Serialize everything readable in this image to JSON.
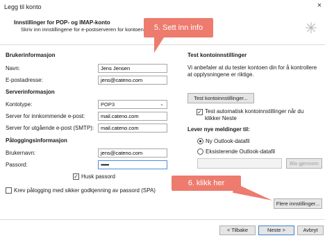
{
  "window": {
    "title": "Legg til konto",
    "close_glyph": "×"
  },
  "header": {
    "title": "Innstillinger for POP- og IMAP-konto",
    "subtitle": "Skriv inn innstillingene for e-postserveren for kontoen din.",
    "icon": "sparkle-cursor-icon"
  },
  "user_info": {
    "heading": "Brukerinformasjon",
    "name_label": "Navn:",
    "name_value": "Jens Jensen",
    "email_label": "E-postadresse:",
    "email_value": "jens@cateno.com"
  },
  "server_info": {
    "heading": "Serverinformasjon",
    "account_type_label": "Kontotype:",
    "account_type_value": "POP3",
    "incoming_label": "Server for innkommende e-post:",
    "incoming_value": "mail.cateno.com",
    "outgoing_label": "Server for utgående e-post (SMTP):",
    "outgoing_value": "mail.cateno.com"
  },
  "login_info": {
    "heading": "Påloggingsinformasjon",
    "username_label": "Brukernavn:",
    "username_value": "jens@cateno.com",
    "password_label": "Passord:",
    "password_value": "•••••••",
    "remember_label": "Husk passord",
    "remember_checked": true,
    "spa_label": "Krev pålogging med sikker godkjenning av passord (SPA)",
    "spa_checked": false
  },
  "test_settings": {
    "heading": "Test kontoinnstillinger",
    "description": "Vi anbefaler at du tester kontoen din for å kontrollere at opplysningene er riktige.",
    "test_button": "Test kontoinnstillinger...",
    "auto_test_label": "Test automatisk kontoinnstillinger når du klikker Neste",
    "auto_test_checked": true
  },
  "deliver": {
    "heading": "Lever nye meldinger til:",
    "option_new": "Ny Outlook-datafil",
    "option_existing": "Eksisterende Outlook-datafil",
    "selected": "new",
    "browse_button": "Bla gjennom"
  },
  "more_settings_button": "Flere innstillinger...",
  "footer": {
    "back_button": "< Tilbake",
    "next_button": "Neste >",
    "cancel_button": "Avbryt"
  },
  "callouts": {
    "step5": "5. Sett inn info",
    "step6": "6. klikk her"
  },
  "colors": {
    "callout": "#ed7b6e",
    "focus_border": "#4c8cdb"
  }
}
